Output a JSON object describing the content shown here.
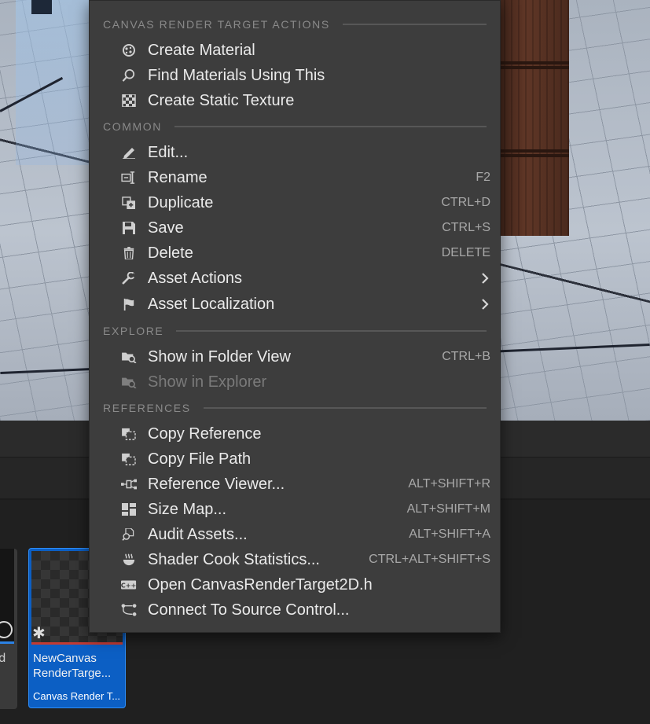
{
  "menu": {
    "sections": {
      "canvas": "CANVAS RENDER TARGET ACTIONS",
      "common": "COMMON",
      "explore": "EXPLORE",
      "references": "REFERENCES"
    },
    "canvas_items": [
      {
        "label": "Create Material",
        "icon": "material-sphere-icon"
      },
      {
        "label": "Find Materials Using This",
        "icon": "magnifier-icon"
      },
      {
        "label": "Create Static Texture",
        "icon": "checker-texture-icon"
      }
    ],
    "common_items": [
      {
        "label": "Edit...",
        "icon": "pencil-icon",
        "shortcut": ""
      },
      {
        "label": "Rename",
        "icon": "rename-icon",
        "shortcut": "F2"
      },
      {
        "label": "Duplicate",
        "icon": "duplicate-icon",
        "shortcut": "CTRL+D"
      },
      {
        "label": "Save",
        "icon": "save-icon",
        "shortcut": "CTRL+S"
      },
      {
        "label": "Delete",
        "icon": "trash-icon",
        "shortcut": "DELETE"
      },
      {
        "label": "Asset Actions",
        "icon": "wrench-icon",
        "submenu": true
      },
      {
        "label": "Asset Localization",
        "icon": "flag-icon",
        "submenu": true
      }
    ],
    "explore_items": [
      {
        "label": "Show in Folder View",
        "icon": "folder-search-icon",
        "shortcut": "CTRL+B",
        "enabled": true
      },
      {
        "label": "Show in Explorer",
        "icon": "folder-search-icon",
        "shortcut": "",
        "enabled": false
      }
    ],
    "reference_items": [
      {
        "label": "Copy Reference",
        "icon": "copy-icon",
        "shortcut": ""
      },
      {
        "label": "Copy File Path",
        "icon": "copy-icon",
        "shortcut": ""
      },
      {
        "label": "Reference Viewer...",
        "icon": "reference-graph-icon",
        "shortcut": "ALT+SHIFT+R"
      },
      {
        "label": "Size Map...",
        "icon": "size-map-icon",
        "shortcut": "ALT+SHIFT+M"
      },
      {
        "label": "Audit Assets...",
        "icon": "audit-icon",
        "shortcut": "ALT+SHIFT+A"
      },
      {
        "label": "Shader Cook Statistics...",
        "icon": "steam-icon",
        "shortcut": "CTRL+ALT+SHIFT+S"
      },
      {
        "label": "Open CanvasRenderTarget2D.h",
        "icon": "cpp-file-icon",
        "shortcut": ""
      },
      {
        "label": "Connect To Source Control...",
        "icon": "source-control-icon",
        "shortcut": ""
      }
    ]
  },
  "content_browser": {
    "partial_tile_label": "d",
    "asset": {
      "name": "NewCanvas RenderTarge...",
      "type": "Canvas Render T..."
    }
  },
  "colors": {
    "menu_bg": "#3d3d3d",
    "selection_blue": "#0c5fc4",
    "asset_bar_red": "#c23b33"
  }
}
